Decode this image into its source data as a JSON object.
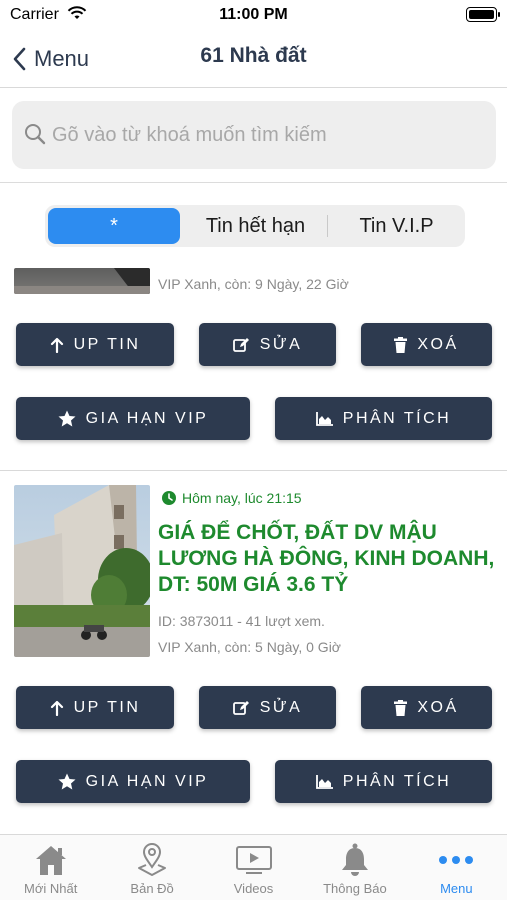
{
  "status_bar": {
    "carrier": "Carrier",
    "time": "11:00 PM"
  },
  "nav": {
    "back_label": "Menu",
    "title": "61 Nhà đất"
  },
  "search": {
    "placeholder": "Gõ vào từ khoá muốn tìm kiếm",
    "value": ""
  },
  "segments": [
    {
      "label": "*",
      "active": true
    },
    {
      "label": "Tin hết hạn",
      "active": false
    },
    {
      "label": "Tin V.I.P",
      "active": false
    }
  ],
  "listing1": {
    "status": "VIP Xanh, còn: 9 Ngày, 22 Giờ"
  },
  "listing2": {
    "time": "Hôm nay, lúc 21:15",
    "title": "GIÁ ĐỂ CHỐT, ĐẤT DV MẬU LƯƠNG HÀ ĐÔNG, KINH DOANH, DT: 50M GIÁ 3.6 TỶ",
    "id_views": "ID: 3873011 - 41 lượt xem.",
    "status": "VIP Xanh, còn: 5 Ngày, 0 Giờ"
  },
  "actions": {
    "up": "UP TIN",
    "edit": "SỬA",
    "delete": "XOÁ",
    "extend": "GIA HẠN VIP",
    "analyze": "PHÂN TÍCH"
  },
  "tabs": [
    {
      "label": "Mới Nhất",
      "icon": "home-icon"
    },
    {
      "label": "Bản Đồ",
      "icon": "map-pin-icon"
    },
    {
      "label": "Videos",
      "icon": "video-icon"
    },
    {
      "label": "Thông Báo",
      "icon": "bell-icon"
    },
    {
      "label": "Menu",
      "icon": "more-icon",
      "active": true
    }
  ],
  "colors": {
    "primary": "#2d3a4f",
    "accent": "#2d8cf0",
    "green": "#1e8a2e",
    "muted": "#8a8a8a"
  }
}
